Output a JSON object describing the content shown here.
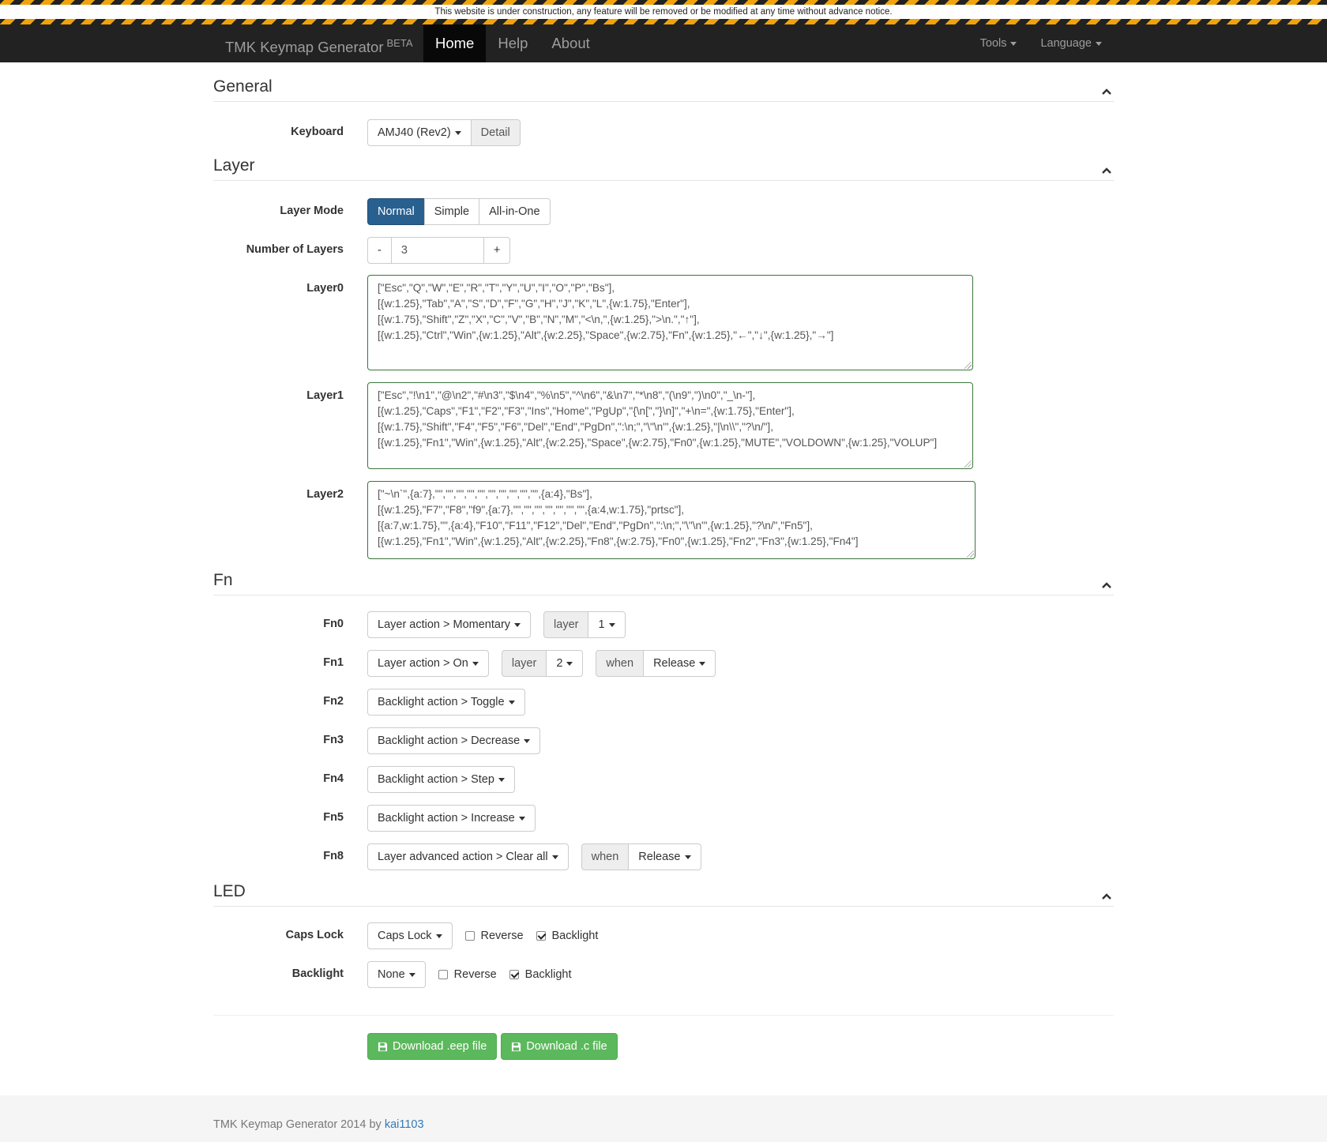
{
  "banner": {
    "text": "This website is under construction, any feature will be removed or be modified at any time without advance notice."
  },
  "navbar": {
    "brand": "TMK Keymap Generator",
    "brand_badge": "BETA",
    "links": [
      {
        "label": "Home",
        "active": true
      },
      {
        "label": "Help"
      },
      {
        "label": "About"
      }
    ],
    "right": {
      "tools": "Tools",
      "language": "Language"
    }
  },
  "general": {
    "title": "General",
    "keyboard_label": "Keyboard",
    "keyboard_value": "AMJ40 (Rev2)",
    "detail_button": "Detail"
  },
  "layer": {
    "title": "Layer",
    "mode_label": "Layer Mode",
    "modes": [
      "Normal",
      "Simple",
      "All-in-One"
    ],
    "selected_mode": "Normal",
    "count_label": "Number of Layers",
    "minus": "-",
    "count": "3",
    "plus": "+",
    "layers": [
      {
        "label": "Layer0",
        "text": "[\"Esc\",\"Q\",\"W\",\"E\",\"R\",\"T\",\"Y\",\"U\",\"I\",\"O\",\"P\",\"Bs\"],\n[{w:1.25},\"Tab\",\"A\",\"S\",\"D\",\"F\",\"G\",\"H\",\"J\",\"K\",\"L\",{w:1.75},\"Enter\"],\n[{w:1.75},\"Shift\",\"Z\",\"X\",\"C\",\"V\",\"B\",\"N\",\"M\",\"<\\n,\",{w:1.25},\">\\n.\",\"↑\"],\n[{w:1.25},\"Ctrl\",\"Win\",{w:1.25},\"Alt\",{w:2.25},\"Space\",{w:2.75},\"Fn\",{w:1.25},\"←\",\"↓\",{w:1.25},\"→\"]"
      },
      {
        "label": "Layer1",
        "text": "[\"Esc\",\"!\\n1\",\"@\\n2\",\"#\\n3\",\"$\\n4\",\"%\\n5\",\"^\\n6\",\"&\\n7\",\"*\\n8\",\"(\\n9\",\")\\n0\",\"_\\n-\"],\n[{w:1.25},\"Caps\",\"F1\",\"F2\",\"F3\",\"Ins\",\"Home\",\"PgUp\",\"{\\n[\",\"}\\n]\",\"+\\n=\",{w:1.75},\"Enter\"],\n[{w:1.75},\"Shift\",\"F4\",\"F5\",\"F6\",\"Del\",\"End\",\"PgDn\",\":\\n;\",\"\\\"\\n'\",{w:1.25},\"|\\n\\\\\",\"?\\n/\"],\n[{w:1.25},\"Fn1\",\"Win\",{w:1.25},\"Alt\",{w:2.25},\"Space\",{w:2.75},\"Fn0\",{w:1.25},\"MUTE\",\"VOLDOWN\",{w:1.25},\"VOLUP\"]"
      },
      {
        "label": "Layer2",
        "text": "[\"~\\n`\",{a:7},\"\",\"\",\"\",\"\",\"\",\"\",\"\",\"\",\"\",\"\",{a:4},\"Bs\"],\n[{w:1.25},\"F7\",\"F8\",\"f9\",{a:7},\"\",\"\",\"\",\"\",\"\",\"\",\"\",{a:4,w:1.75},\"prtsc\"],\n[{a:7,w:1.75},\"\",{a:4},\"F10\",\"F11\",\"F12\",\"Del\",\"End\",\"PgDn\",\":\\n;\",\"\\\"\\n'\",{w:1.25},\"?\\n/\",\"Fn5\"],\n[{w:1.25},\"Fn1\",\"Win\",{w:1.25},\"Alt\",{w:2.25},\"Fn8\",{w:2.75},\"Fn0\",{w:1.25},\"Fn2\",\"Fn3\",{w:1.25},\"Fn4\"]"
      }
    ]
  },
  "fn": {
    "title": "Fn",
    "rows": [
      {
        "label": "Fn0",
        "action": "Layer action > Momentary",
        "layer_addon": "layer",
        "layer_value": "1"
      },
      {
        "label": "Fn1",
        "action": "Layer action > On",
        "layer_addon": "layer",
        "layer_value": "2",
        "when_addon": "when",
        "when_value": "Release"
      },
      {
        "label": "Fn2",
        "action": "Backlight action > Toggle"
      },
      {
        "label": "Fn3",
        "action": "Backlight action > Decrease"
      },
      {
        "label": "Fn4",
        "action": "Backlight action > Step"
      },
      {
        "label": "Fn5",
        "action": "Backlight action > Increase"
      },
      {
        "label": "Fn8",
        "action": "Layer advanced action > Clear all",
        "when_addon": "when",
        "when_value": "Release"
      }
    ]
  },
  "led": {
    "title": "LED",
    "rows": [
      {
        "label": "Caps Lock",
        "value": "Caps Lock",
        "reverse": "Reverse",
        "reverse_checked": false,
        "backlight": "Backlight",
        "backlight_checked": true
      },
      {
        "label": "Backlight",
        "value": "None",
        "reverse": "Reverse",
        "reverse_checked": false,
        "backlight": "Backlight",
        "backlight_checked": true
      }
    ]
  },
  "download": {
    "eep": "Download .eep file",
    "c": "Download .c file"
  },
  "footer": {
    "text": "TMK Keymap Generator 2014 by",
    "author": "kai1103"
  },
  "colors": {
    "primary": "#286090",
    "success": "#5cb85c",
    "navbar": "#222222",
    "valid_border": "#3c763d",
    "link": "#337ab7"
  }
}
